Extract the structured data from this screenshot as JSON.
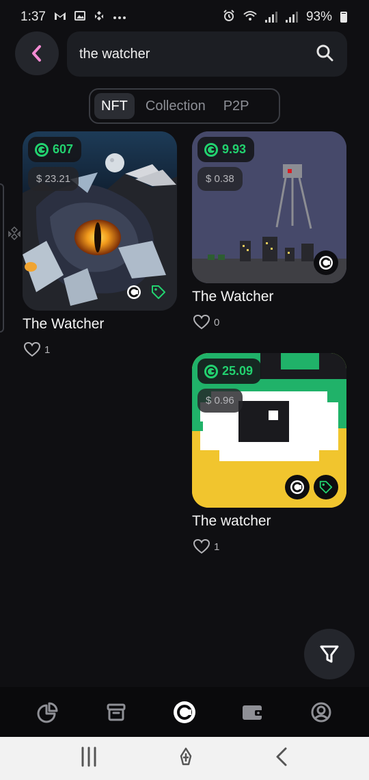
{
  "status_bar": {
    "time": "1:37",
    "left_icons": [
      "gmail-icon",
      "image-icon",
      "binance-icon",
      "more-dots-icon"
    ],
    "right_icons": [
      "alarm-icon",
      "wifi-icon",
      "signal-icon",
      "signal-icon"
    ],
    "battery": "93%"
  },
  "header": {
    "back_icon": "chevron-left-icon",
    "search": {
      "value": "the watcher",
      "icon": "search-icon"
    }
  },
  "tabs": [
    {
      "label": "NFT",
      "active": true
    },
    {
      "label": "Collection",
      "active": false
    },
    {
      "label": "P2P",
      "active": false
    }
  ],
  "results": [
    {
      "title": "The Watcher",
      "price": "607",
      "usd": "$ 23.21",
      "likes": "1",
      "badges": [
        "coin-badge-icon",
        "tag-icon"
      ]
    },
    {
      "title": "The Watcher",
      "price": "9.93",
      "usd": "$ 0.38",
      "likes": "0",
      "badges": [
        "coin-badge-icon"
      ]
    },
    {
      "title": "The watcher",
      "price": "25.09",
      "usd": "$ 0.96",
      "likes": "1",
      "badges": [
        "coin-badge-icon",
        "tag-icon"
      ]
    }
  ],
  "filter_icon": "filter-icon",
  "bottom_nav": [
    "portfolio-chart-icon",
    "archive-box-icon",
    "coin-logo-icon",
    "wallet-icon",
    "profile-icon"
  ],
  "system_nav": [
    "recent-apps-icon",
    "home-icon",
    "back-icon"
  ],
  "colors": {
    "accent": "#22d26f",
    "back_chevron": "#f38bd3",
    "background": "#0f0f12"
  }
}
